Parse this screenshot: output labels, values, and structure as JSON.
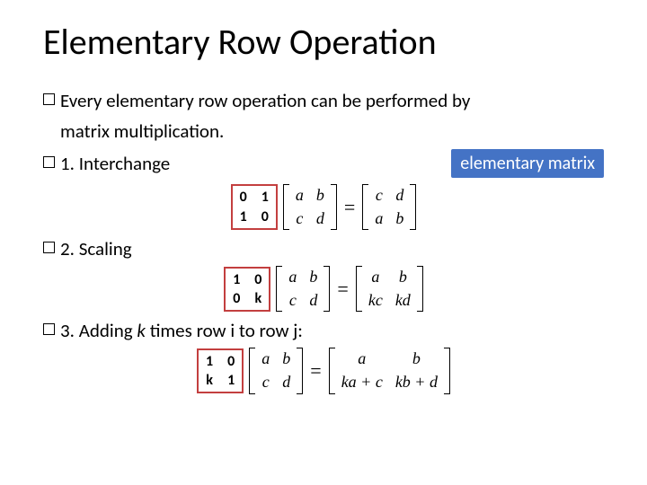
{
  "title": "Elementary Row Operation",
  "intro_part1": "Every elementary row operation can be performed by",
  "intro_part2": "matrix multiplication.",
  "badge": "elementary matrix",
  "items": {
    "interchange": {
      "label": "1. Interchange"
    },
    "scaling": {
      "label": "2. Scaling"
    },
    "addrow": {
      "label_pre": "3. Adding ",
      "k": "k",
      "label_mid": " times row i to row j:"
    }
  },
  "eq": {
    "equals": "=",
    "m1": {
      "e": [
        [
          "0",
          "1"
        ],
        [
          "1",
          "0"
        ]
      ],
      "abcd": [
        [
          "a",
          "b"
        ],
        [
          "c",
          "d"
        ]
      ],
      "res": [
        [
          "c",
          "d"
        ],
        [
          "a",
          "b"
        ]
      ]
    },
    "m2": {
      "e": [
        [
          "1",
          "0"
        ],
        [
          "0",
          "k"
        ]
      ],
      "abcd": [
        [
          "a",
          "b"
        ],
        [
          "c",
          "d"
        ]
      ],
      "res": [
        [
          "a",
          "b"
        ],
        [
          "kc",
          "kd"
        ]
      ]
    },
    "m3": {
      "e": [
        [
          "1",
          "0"
        ],
        [
          "k",
          "1"
        ]
      ],
      "abcd": [
        [
          "a",
          "b"
        ],
        [
          "c",
          "d"
        ]
      ],
      "res": [
        [
          "a",
          "b"
        ],
        [
          "ka + c",
          "kb + d"
        ]
      ]
    }
  }
}
